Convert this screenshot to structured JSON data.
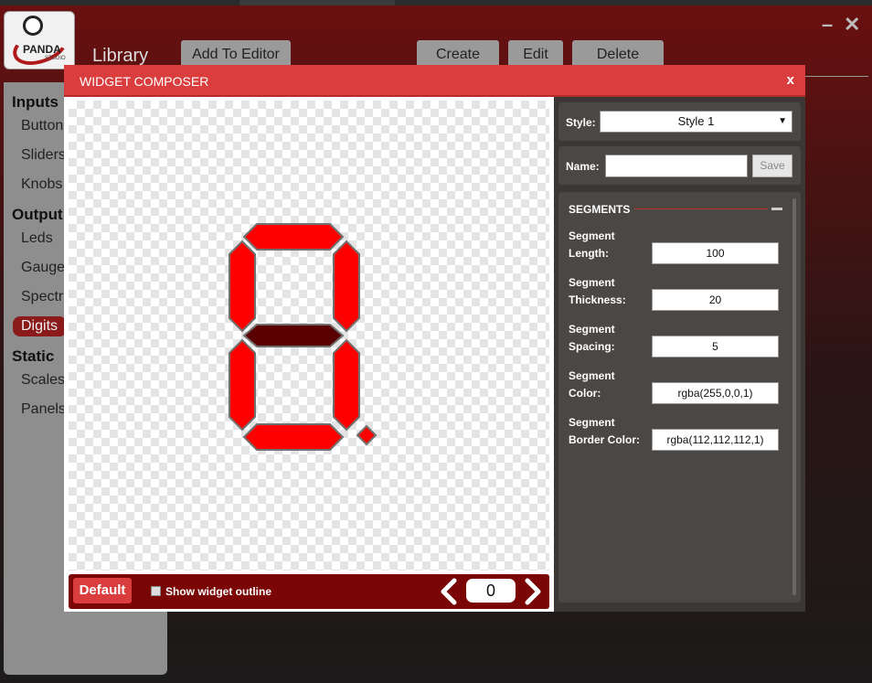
{
  "app": {
    "logo_text": "PANDA",
    "logo_sub": "STUDIO",
    "library_title": "Library",
    "add_to_editor_label": "Add To Editor",
    "create_label": "Create",
    "edit_label": "Edit",
    "delete_label": "Delete",
    "minimize_glyph": "–",
    "close_glyph": "✕"
  },
  "sidebar": {
    "sections": [
      {
        "title": "Inputs",
        "items": [
          "Buttons",
          "Sliders",
          "Knobs"
        ]
      },
      {
        "title": "Outputs",
        "items": [
          "Leds",
          "Gauges",
          "Spectrum",
          "Digits"
        ]
      },
      {
        "title": "Static",
        "items": [
          "Scales",
          "Panels"
        ]
      }
    ],
    "display": {
      "inputs": "Inputs",
      "buttons": "Button",
      "sliders": "Sliders",
      "knobs": "Knobs",
      "outputs": "Output",
      "leds": "Leds",
      "gauges": "Gauge",
      "spectrum": "Spectr",
      "digits": "Digits",
      "static": "Static",
      "scales": "Scales",
      "panels": "Panels"
    },
    "active_item": "Digits"
  },
  "dialog": {
    "title": "WIDGET COMPOSER",
    "close_label": "x",
    "default_label": "Default",
    "show_outline_label": "Show widget outline",
    "show_outline_checked": false,
    "counter_value": "0",
    "style_label": "Style:",
    "style_value": "Style 1",
    "style_caret": "▼",
    "name_label": "Name:",
    "name_value": "",
    "save_label": "Save",
    "segments_header": "SEGMENTS",
    "properties": [
      {
        "label_line1": "Segment",
        "label_line2": "Length:",
        "value": "100"
      },
      {
        "label_line1": "Segment",
        "label_line2": "Thickness:",
        "value": "20"
      },
      {
        "label_line1": "Segment",
        "label_line2": "Spacing:",
        "value": "5"
      },
      {
        "label_line1": "Segment",
        "label_line2": "Color:",
        "value": "rgba(255,0,0,1)"
      },
      {
        "label_line1": "Segment",
        "label_line2": "Border Color:",
        "value": "rgba(112,112,112,1)"
      }
    ]
  },
  "digit": {
    "on_color": "#ff0000",
    "off_color": "#5a0000",
    "border_color": "#707070",
    "segments_on": [
      "a",
      "b",
      "c",
      "d",
      "e",
      "f",
      "dp"
    ],
    "segments_off": [
      "g"
    ]
  },
  "colors": {
    "accent_red": "#d93d3d",
    "footer_red": "#7a0606",
    "panel_dark": "#3a3734"
  }
}
